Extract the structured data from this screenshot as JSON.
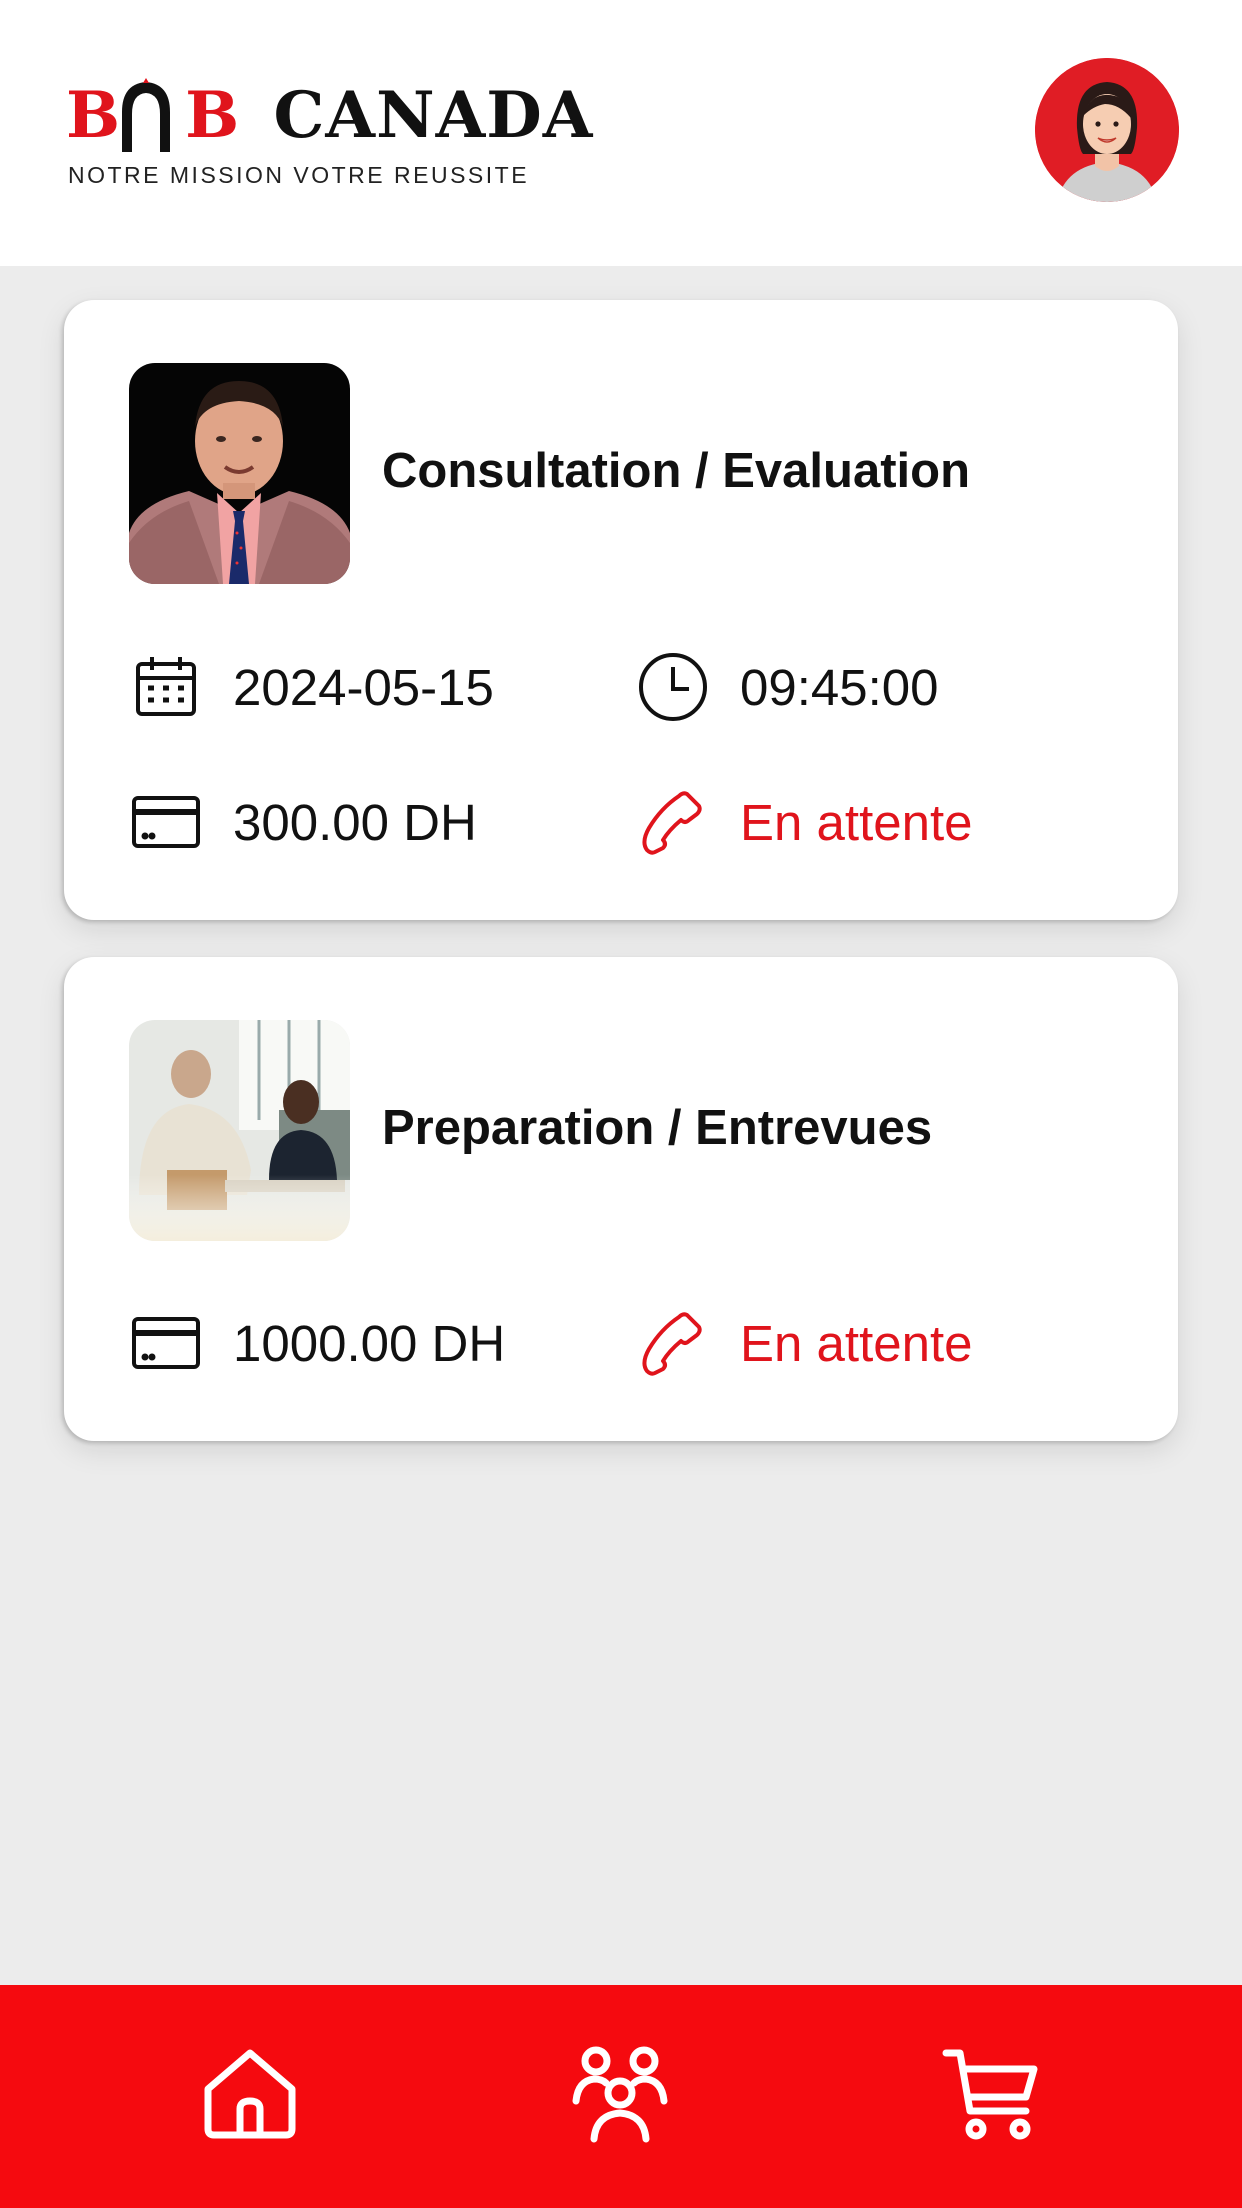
{
  "brand": {
    "logo_part1": "B",
    "logo_part2": "B",
    "logo_part3": "CANADA",
    "tagline": "NOTRE MISSION VOTRE REUSSITE",
    "accent_color": "#e0141c"
  },
  "header": {
    "avatar_icon": "user-avatar-icon"
  },
  "appointments": [
    {
      "title": "Consultation / Evaluation",
      "date": "2024-05-15",
      "time": "09:45:00",
      "price": "300.00 DH",
      "status": "En attente"
    },
    {
      "title": "Preparation / Entrevues",
      "price": "1000.00 DH",
      "status": "En attente"
    }
  ],
  "nav": {
    "items": [
      {
        "icon": "home-icon"
      },
      {
        "icon": "team-icon"
      },
      {
        "icon": "cart-icon"
      }
    ],
    "background": "#f50a0f"
  }
}
